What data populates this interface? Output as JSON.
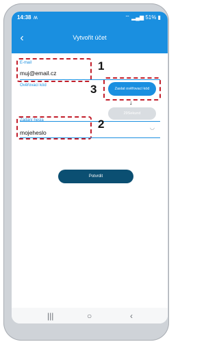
{
  "status_bar": {
    "time": "14:38",
    "notification": "ʍ",
    "signal_battery": "51%"
  },
  "header": {
    "title": "Vytvořit účet",
    "back_icon": "chevron-left-icon"
  },
  "form": {
    "email_label": "E-mail",
    "email_value": "muj@email.cz",
    "code_label": "Ověřovací kód",
    "send_code_button": "Zaslat ověřovací kód",
    "timer_button": "29Sekund",
    "password_label": "Zadání hesla",
    "password_value": "mojeheslo",
    "confirm_button": "Potvrdit"
  },
  "annotations": {
    "one": "1",
    "two": "2",
    "three": "3"
  },
  "colors": {
    "accent": "#1a8fe0",
    "confirm": "#0b4f72",
    "annotation": "#c21d2a"
  },
  "nav_bar": {
    "recent": "|||",
    "home": "○",
    "back": "‹"
  }
}
